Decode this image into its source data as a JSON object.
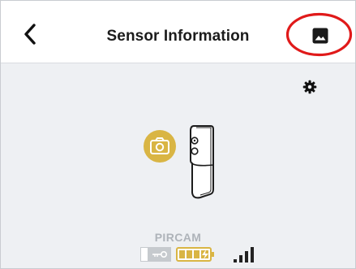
{
  "header": {
    "title": "Sensor Information",
    "back_icon": "chevron-left-icon",
    "gallery_icon": "image-gallery-icon"
  },
  "toolbar": {
    "settings_icon": "gear-icon"
  },
  "device": {
    "name": "PIRCAM",
    "type_icon": "camera-icon",
    "badge_color": "#d9b544",
    "status": {
      "lock_icon": "key-icon",
      "battery_icon": "battery-charging-icon",
      "battery_level": 1.0,
      "signal_icon": "signal-strength-icon",
      "signal_bars": 4,
      "signal_max": 4
    }
  },
  "colors": {
    "accent": "#d9b544",
    "highlight": "#e01a1a",
    "background": "#eef0f3",
    "header": "#ffffff",
    "text": "#1c1c1c",
    "muted": "#aeb3b9"
  }
}
